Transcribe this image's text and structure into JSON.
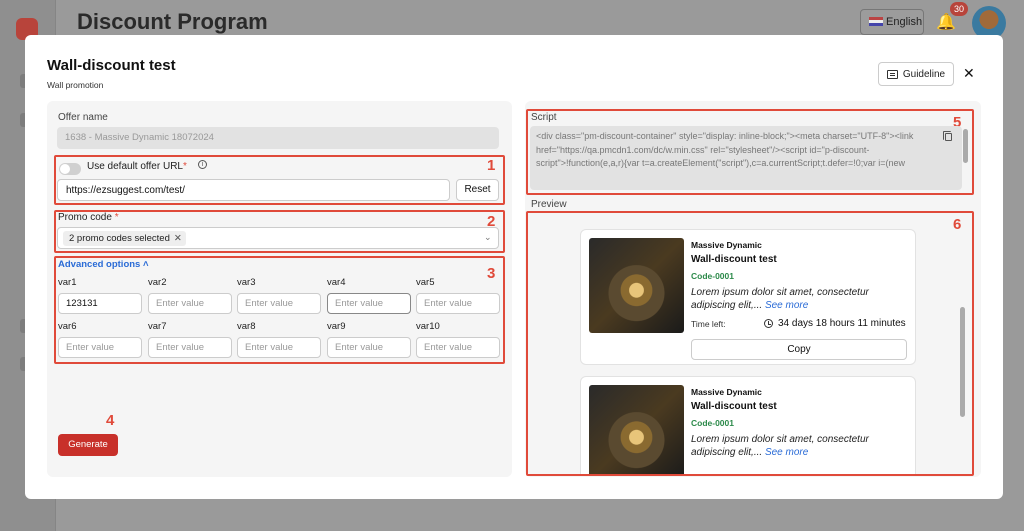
{
  "background": {
    "page_title": "Discount Program",
    "language": "English",
    "notifications_count": "30"
  },
  "modal": {
    "title": "Wall-discount test",
    "subtitle": "Wall promotion",
    "guideline_label": "Guideline",
    "close_glyph": "✕"
  },
  "form": {
    "offer_name_label": "Offer name",
    "offer_name_value": "1638 - Massive Dynamic 18072024",
    "use_default_url_label": "Use default offer URL",
    "required_mark": "*",
    "info_glyph": "i",
    "url_value": "https://ezsuggest.com/test/",
    "reset_label": "Reset",
    "promo_code_label": "Promo code",
    "promo_selected": "2 promo codes selected",
    "tag_remove_glyph": "✕",
    "chevron_glyph": "⌄",
    "advanced_options_label": "Advanced options ˄",
    "vars": [
      {
        "label": "var1",
        "value": "123131",
        "placeholder": "Enter value"
      },
      {
        "label": "var2",
        "value": "",
        "placeholder": "Enter value"
      },
      {
        "label": "var3",
        "value": "",
        "placeholder": "Enter value"
      },
      {
        "label": "var4",
        "value": "",
        "placeholder": "Enter value"
      },
      {
        "label": "var5",
        "value": "",
        "placeholder": "Enter value"
      },
      {
        "label": "var6",
        "value": "",
        "placeholder": "Enter value"
      },
      {
        "label": "var7",
        "value": "",
        "placeholder": "Enter value"
      },
      {
        "label": "var8",
        "value": "",
        "placeholder": "Enter value"
      },
      {
        "label": "var9",
        "value": "",
        "placeholder": "Enter value"
      },
      {
        "label": "var10",
        "value": "",
        "placeholder": "Enter value"
      }
    ],
    "generate_label": "Generate"
  },
  "script": {
    "label": "Script",
    "code": "<div class=\"pm-discount-container\" style=\"display: inline-block;\"><meta charset=\"UTF-8\"><link href=\"https://qa.pmcdn1.com/dc/w.min.css\" rel=\"stylesheet\"/><script id=\"p-discount-script\">!function(e,a,r){var t=a.createElement(\"script\"),c=a.currentScript;t.defer=!0;var i=(new"
  },
  "preview": {
    "label": "Preview",
    "cards": [
      {
        "brand": "Massive Dynamic",
        "title": "Wall-discount test",
        "code": "Code-0001",
        "description": "Lorem ipsum dolor sit amet, consectetur adipiscing elit,...",
        "see_more": "See more",
        "time_left_label": "Time left:",
        "time_left": "34 days 18 hours 11 minutes",
        "copy_label": "Copy"
      },
      {
        "brand": "Massive Dynamic",
        "title": "Wall-discount test",
        "code": "Code-0001",
        "description": "Lorem ipsum dolor sit amet, consectetur adipiscing elit,...",
        "see_more": "See more"
      }
    ]
  },
  "annotations": [
    "1",
    "2",
    "3",
    "4",
    "5",
    "6"
  ],
  "colors": {
    "annotation": "#e04a3a",
    "primary_button": "#c8302a",
    "link": "#2a6bd6",
    "code_green": "#2c8a4a"
  }
}
